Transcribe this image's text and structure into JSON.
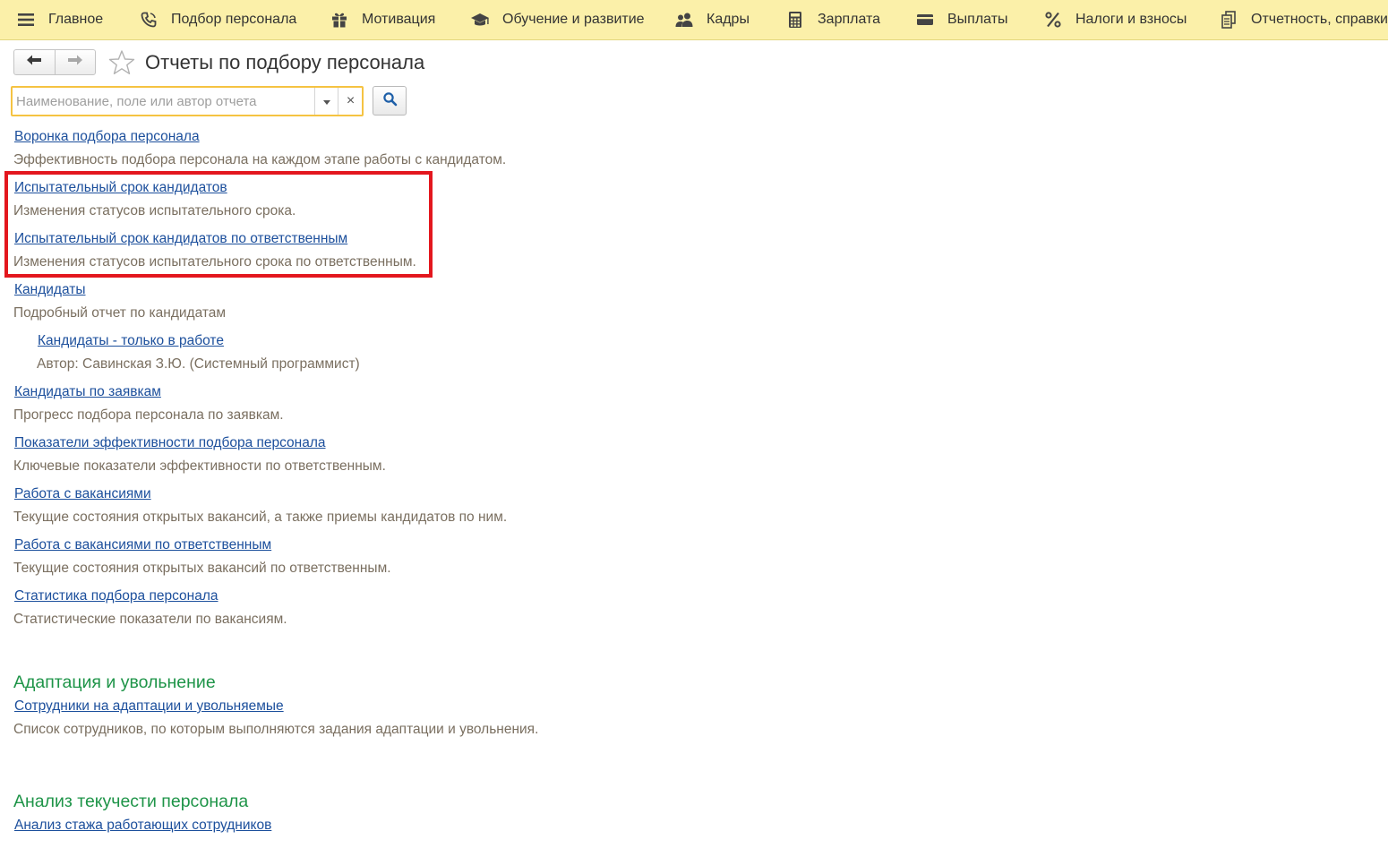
{
  "nav": {
    "items": [
      {
        "label": "Главное",
        "icon": "menu-icon"
      },
      {
        "label": "Подбор персонала",
        "icon": "phone-icon"
      },
      {
        "label": "Мотивация",
        "icon": "gift-icon"
      },
      {
        "label": "Обучение и развитие",
        "icon": "graduation-cap-icon"
      },
      {
        "label": "Кадры",
        "icon": "users-icon"
      },
      {
        "label": "Зарплата",
        "icon": "calculator-icon"
      },
      {
        "label": "Выплаты",
        "icon": "wallet-icon"
      },
      {
        "label": "Налоги и взносы",
        "icon": "percent-icon"
      },
      {
        "label": "Отчетность, справки",
        "icon": "documents-icon"
      }
    ]
  },
  "header": {
    "title": "Отчеты по подбору персонала"
  },
  "search": {
    "placeholder": "Наименование, поле или автор отчета",
    "value": "",
    "clear_glyph": "×"
  },
  "reports": [
    {
      "title": "Воронка подбора персонала",
      "description": "Эффективность подбора персонала на каждом этапе работы с кандидатом."
    },
    {
      "title": "Испытательный срок кандидатов",
      "description": "Изменения статусов испытательного срока."
    },
    {
      "title": "Испытательный срок кандидатов по ответственным",
      "description": "Изменения статусов испытательного срока по ответственным."
    },
    {
      "title": "Кандидаты",
      "description": "Подробный отчет по кандидатам"
    },
    {
      "title": "Кандидаты - только в работе",
      "description": "Автор: Савинская З.Ю. (Системный программист)"
    },
    {
      "title": "Кандидаты по заявкам",
      "description": "Прогресс подбора персонала по заявкам."
    },
    {
      "title": "Показатели эффективности подбора персонала",
      "description": "Ключевые показатели эффективности по ответственным."
    },
    {
      "title": "Работа с вакансиями",
      "description": "Текущие состояния открытых вакансий, а также приемы кандидатов по ним."
    },
    {
      "title": "Работа с вакансиями по ответственным",
      "description": "Текущие состояния открытых вакансий по ответственным."
    },
    {
      "title": "Статистика подбора персонала",
      "description": "Статистические показатели по вакансиям."
    }
  ],
  "sections": [
    {
      "title": "Адаптация и увольнение",
      "reports": [
        {
          "title": "Сотрудники на адаптации и увольняемые",
          "description": "Список сотрудников, по которым выполняются задания адаптации и увольнения."
        }
      ]
    },
    {
      "title": "Анализ текучести персонала",
      "reports": [
        {
          "title": "Анализ стажа работающих сотрудников"
        }
      ]
    }
  ],
  "colors": {
    "nav_background": "#fbf0a9",
    "link": "#1c4f9c",
    "description": "#7a6f60",
    "section_title": "#1e9448",
    "highlight_border": "#e3171e",
    "search_border": "#f5c342"
  }
}
